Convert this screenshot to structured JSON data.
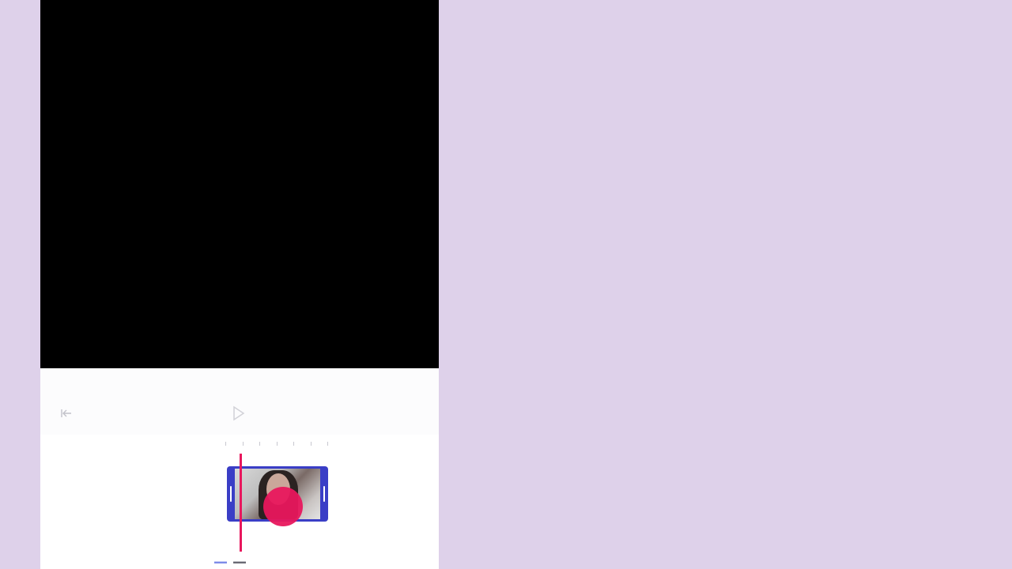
{
  "colors": {
    "background": "#ded1ea",
    "preview": "#000000",
    "clip_border": "#3a3ec6",
    "playhead": "#e8175d",
    "touch_indicator": "#e8175d",
    "time_current": "#7d8be8"
  },
  "toolbar": {
    "back_icon": "back-icon",
    "play_icon": "play-icon"
  },
  "timeline": {
    "clip_thumbnail": "video-frame-thumbnail"
  }
}
